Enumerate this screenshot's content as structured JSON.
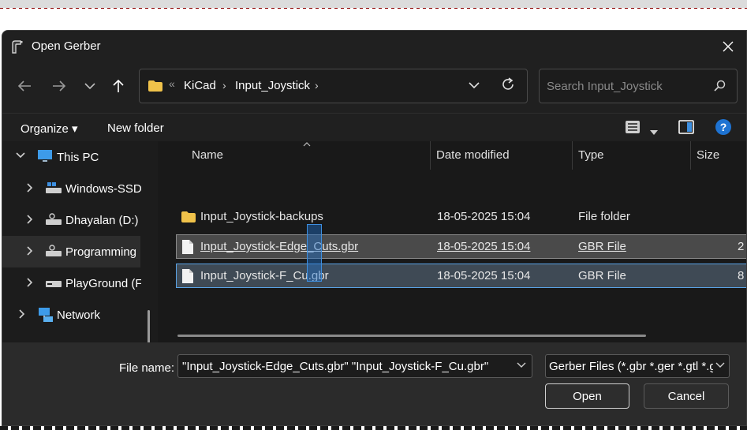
{
  "window": {
    "title": "Open Gerber"
  },
  "address": {
    "overflow_chevron": "«",
    "crumbs": [
      "KiCad",
      "Input_Joystick"
    ],
    "separator": "›"
  },
  "search": {
    "placeholder": "Search Input_Joystick"
  },
  "commands": {
    "organize": "Organize ▾",
    "new_folder": "New folder"
  },
  "sidebar": {
    "items": [
      {
        "label": "This PC",
        "icon": "monitor-icon"
      },
      {
        "label": "Windows-SSD",
        "icon": "drive-icon"
      },
      {
        "label": "Dhayalan (D:)",
        "icon": "drive-icon"
      },
      {
        "label": "Programming",
        "icon": "drive-icon"
      },
      {
        "label": "PlayGround (F:",
        "icon": "drive-icon"
      },
      {
        "label": "Network",
        "icon": "network-icon"
      }
    ]
  },
  "columns": {
    "name": "Name",
    "date": "Date modified",
    "type": "Type",
    "size": "Size"
  },
  "files": [
    {
      "name": "Input_Joystick-backups",
      "date": "18-05-2025 15:04",
      "type": "File folder",
      "size": "",
      "icon": "folder-icon"
    },
    {
      "name": "Input_Joystick-Edge_Cuts.gbr",
      "date": "18-05-2025 15:04",
      "type": "GBR File",
      "size": "2",
      "icon": "file-icon"
    },
    {
      "name": "Input_Joystick-F_Cu.gbr",
      "date": "18-05-2025 15:04",
      "type": "GBR File",
      "size": "8",
      "icon": "file-icon"
    }
  ],
  "footer": {
    "file_name_label": "File name:",
    "file_name_value": "\"Input_Joystick-Edge_Cuts.gbr\" \"Input_Joystick-F_Cu.gbr\"",
    "file_type_value": "Gerber Files (*.gbr *.ger *.gtl *.g",
    "open_label": "Open",
    "cancel_label": "Cancel"
  },
  "colors": {
    "dialog_bg": "#202020",
    "accent_blue": "#3d8fe0",
    "folder_yellow": "#f0c24a"
  }
}
